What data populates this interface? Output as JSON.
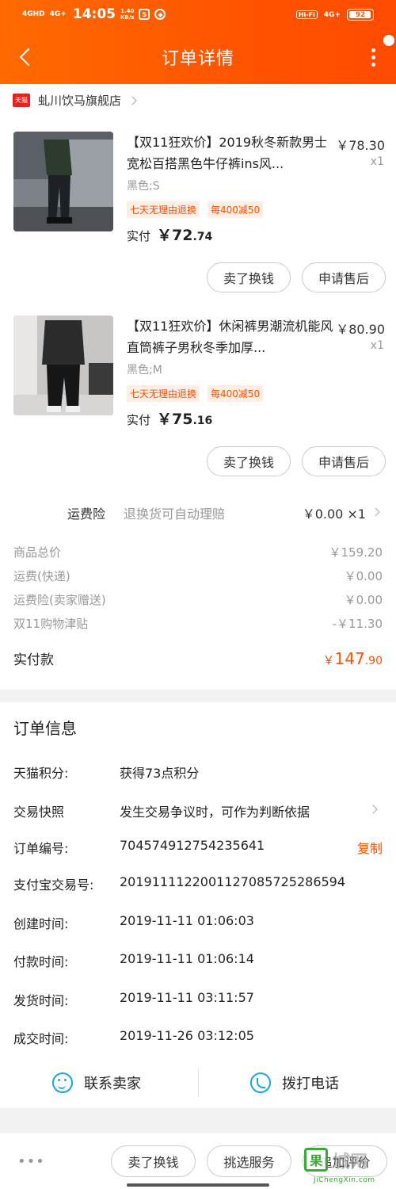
{
  "status_bar": {
    "signal1": "4GHD",
    "signal2": "4G+",
    "time": "14:05",
    "speed_value": "1.40",
    "speed_unit": "KB/s",
    "hifi": "Hi-Fi",
    "network": "4G+",
    "battery": "92"
  },
  "header": {
    "title": "订单详情",
    "icons": [
      "back-arrow-icon",
      "more-vertical-icon"
    ]
  },
  "store": {
    "badge": "天猫",
    "name": "虬川饮马旗舰店"
  },
  "products": [
    {
      "name": "【双11狂欢价】2019秋冬新款男士宽松百搭黑色牛仔裤ins风...",
      "price": "￥78.30",
      "qty": "x1",
      "sku": "黑色;S",
      "tags": [
        "七天无理由退换",
        "每400减50"
      ],
      "paid_label": "实付",
      "paid_main": "￥72",
      "paid_decimal": ".74",
      "button_sell": "卖了换钱",
      "button_aftersale": "申请售后"
    },
    {
      "name": "【双11狂欢价】休闲裤男潮流机能风直筒裤子男秋冬季加厚...",
      "price": "￥80.90",
      "qty": "x1",
      "sku": "黑色;M",
      "tags": [
        "七天无理由退换",
        "每400减50"
      ],
      "paid_label": "实付",
      "paid_main": "￥75",
      "paid_decimal": ".16",
      "button_sell": "卖了换钱",
      "button_aftersale": "申请售后"
    }
  ],
  "insurance": {
    "label": "运费险",
    "desc": "退换货可自动理赔",
    "value": "￥0.00 ×1"
  },
  "summary": [
    {
      "label": "商品总价",
      "value": "￥159.20"
    },
    {
      "label": "运费(快递)",
      "value": "￥0.00"
    },
    {
      "label": "运费险(卖家赠送)",
      "value": "￥0.00"
    },
    {
      "label": "双11购物津贴",
      "value": "-￥11.30"
    }
  ],
  "total": {
    "label": "实付款",
    "main": "147",
    "currency": "￥",
    "decimal": ".90"
  },
  "order_info": {
    "title": "订单信息",
    "rows": [
      {
        "key": "天猫积分:",
        "value": "获得73点积分"
      },
      {
        "key": "交易快照",
        "value": "发生交易争议时，可作为判断依据"
      },
      {
        "key": "订单编号:",
        "value": "704574912754235641",
        "action": "复制"
      },
      {
        "key": "支付宝交易号:",
        "value": "2019111122001127085725286594"
      },
      {
        "key": "创建时间:",
        "value": "2019-11-11 01:06:03"
      },
      {
        "key": "付款时间:",
        "value": "2019-11-11 01:06:14"
      },
      {
        "key": "发货时间:",
        "value": "2019-11-11 03:11:57"
      },
      {
        "key": "成交时间:",
        "value": "2019-11-26 03:12:05"
      }
    ]
  },
  "contact": {
    "seller": "联系卖家",
    "phone": "拨打电话"
  },
  "bottom_bar": {
    "more": "•••",
    "sell": "卖了换钱",
    "service": "挑选服务",
    "review": "追加评价"
  },
  "watermark": {
    "logo": "果",
    "text": "城网",
    "url": "JiChengXin.com"
  },
  "colors": {
    "accent": "#ff5000",
    "header_start": "#ff6a00",
    "header_end": "#ff4b00",
    "link_blue": "#1ba6e0"
  }
}
